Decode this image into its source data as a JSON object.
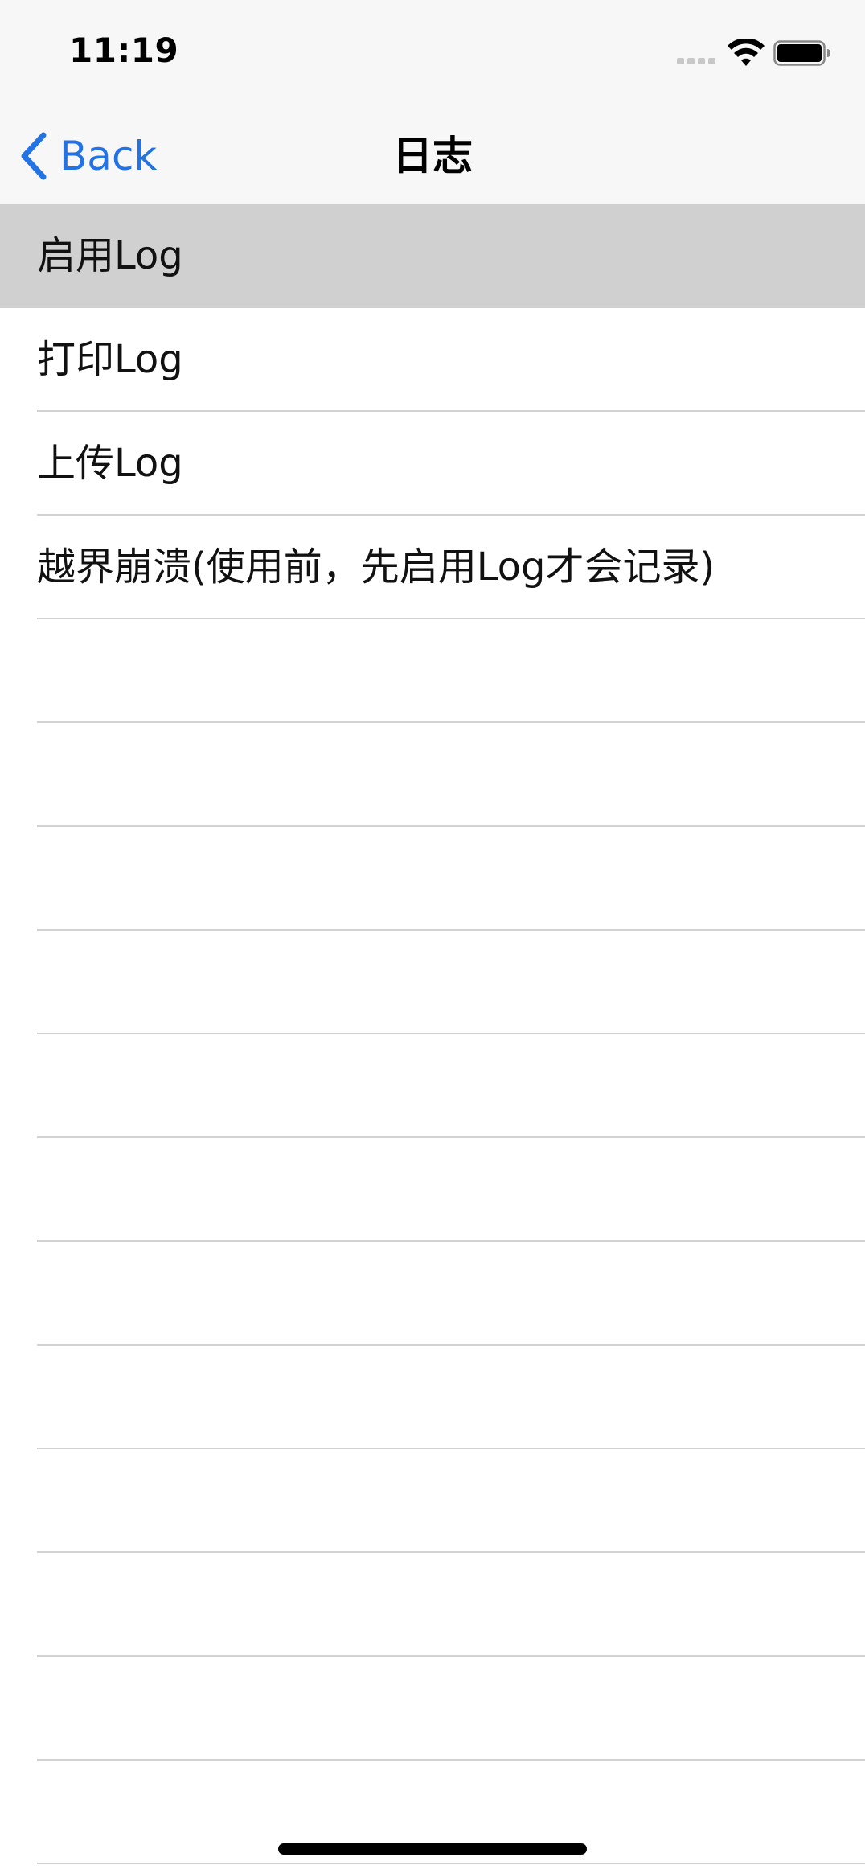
{
  "status_bar": {
    "time": "11:19",
    "icons": [
      "cellular-signal-icon",
      "wifi-icon",
      "battery-icon"
    ]
  },
  "nav_bar": {
    "back_label": "Back",
    "back_icon": "chevron-left-icon",
    "title": "日志",
    "accent_color": "#2473e4"
  },
  "table": {
    "rows": [
      {
        "label": "启用Log",
        "selected": true
      },
      {
        "label": "打印Log",
        "selected": false
      },
      {
        "label": "上传Log",
        "selected": false
      },
      {
        "label": "越界崩溃(使用前，先启用Log才会记录)",
        "selected": false
      }
    ],
    "empty_rows": 12
  }
}
